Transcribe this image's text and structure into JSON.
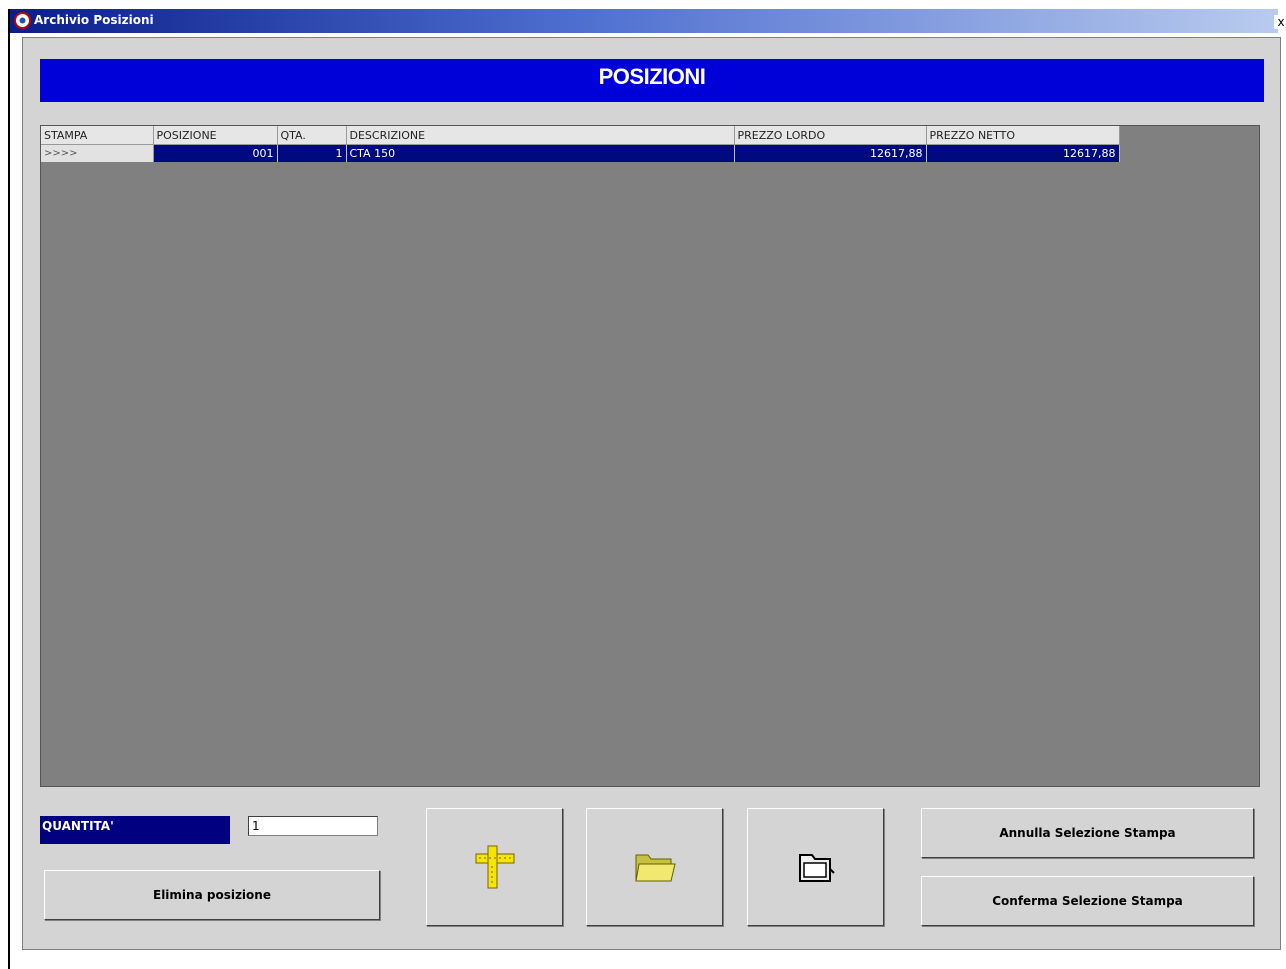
{
  "window": {
    "title": "Archivio Posizioni",
    "close_label": "x"
  },
  "header": {
    "title": "POSIZIONI"
  },
  "table": {
    "columns": [
      "STAMPA",
      "POSIZIONE",
      "QTA.",
      "DESCRIZIONE",
      "PREZZO LORDO",
      "PREZZO NETTO"
    ],
    "rows": [
      {
        "stampa": ">>>>",
        "posizione": "001",
        "qta": "1",
        "descrizione": "CTA 150",
        "prezzo_lordo": "12617,88",
        "prezzo_netto": "12617,88"
      }
    ]
  },
  "quantity": {
    "label": "QUANTITA'",
    "value": "1"
  },
  "buttons": {
    "delete": "Elimina posizione",
    "cancel_print": "Annulla Selezione Stampa",
    "confirm_print": "Conferma Selezione Stampa"
  },
  "icons": {
    "tool": "ruler-square-icon",
    "open": "open-folder-icon",
    "archive": "closed-folder-icon"
  },
  "colors": {
    "header_bg": "#0000d8",
    "grid_bg": "#808080",
    "row_selected": "#000a80",
    "panel_bg": "#d4d4d4"
  }
}
